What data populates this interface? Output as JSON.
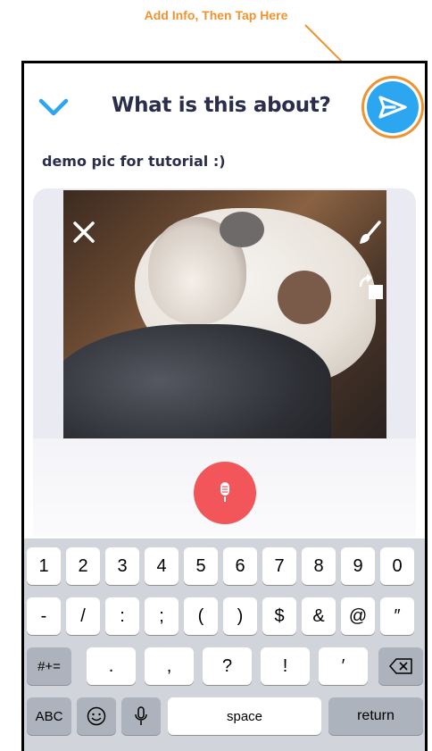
{
  "annotation": {
    "text": "Add Info, Then Tap Here",
    "color": "#F0922F"
  },
  "header": {
    "title": "What is this about?"
  },
  "caption": "demo pic for tutorial :)",
  "icons": {
    "collapse": "chevron-down-icon",
    "send": "send-icon",
    "close": "close-icon",
    "draw": "brush-icon",
    "rotate": "rotate-icon",
    "mic": "microphone-icon"
  },
  "colors": {
    "accent": "#2DA6F2",
    "mic": "#F2555A",
    "annotation": "#F0922F",
    "title": "#2B2D4D"
  },
  "keyboard": {
    "row1": [
      "1",
      "2",
      "3",
      "4",
      "5",
      "6",
      "7",
      "8",
      "9",
      "0"
    ],
    "row2": [
      "-",
      "/",
      ":",
      ";",
      "(",
      ")",
      "$",
      "&",
      "@",
      "″"
    ],
    "row3": {
      "symbols": "#+=",
      "keys": [
        ".",
        ",",
        "?",
        "!",
        "′"
      ],
      "backspace": "⌫"
    },
    "row4": {
      "abc": "ABC",
      "emoji": "☺",
      "dictation": "🎙",
      "space": "space",
      "return": "return"
    }
  }
}
